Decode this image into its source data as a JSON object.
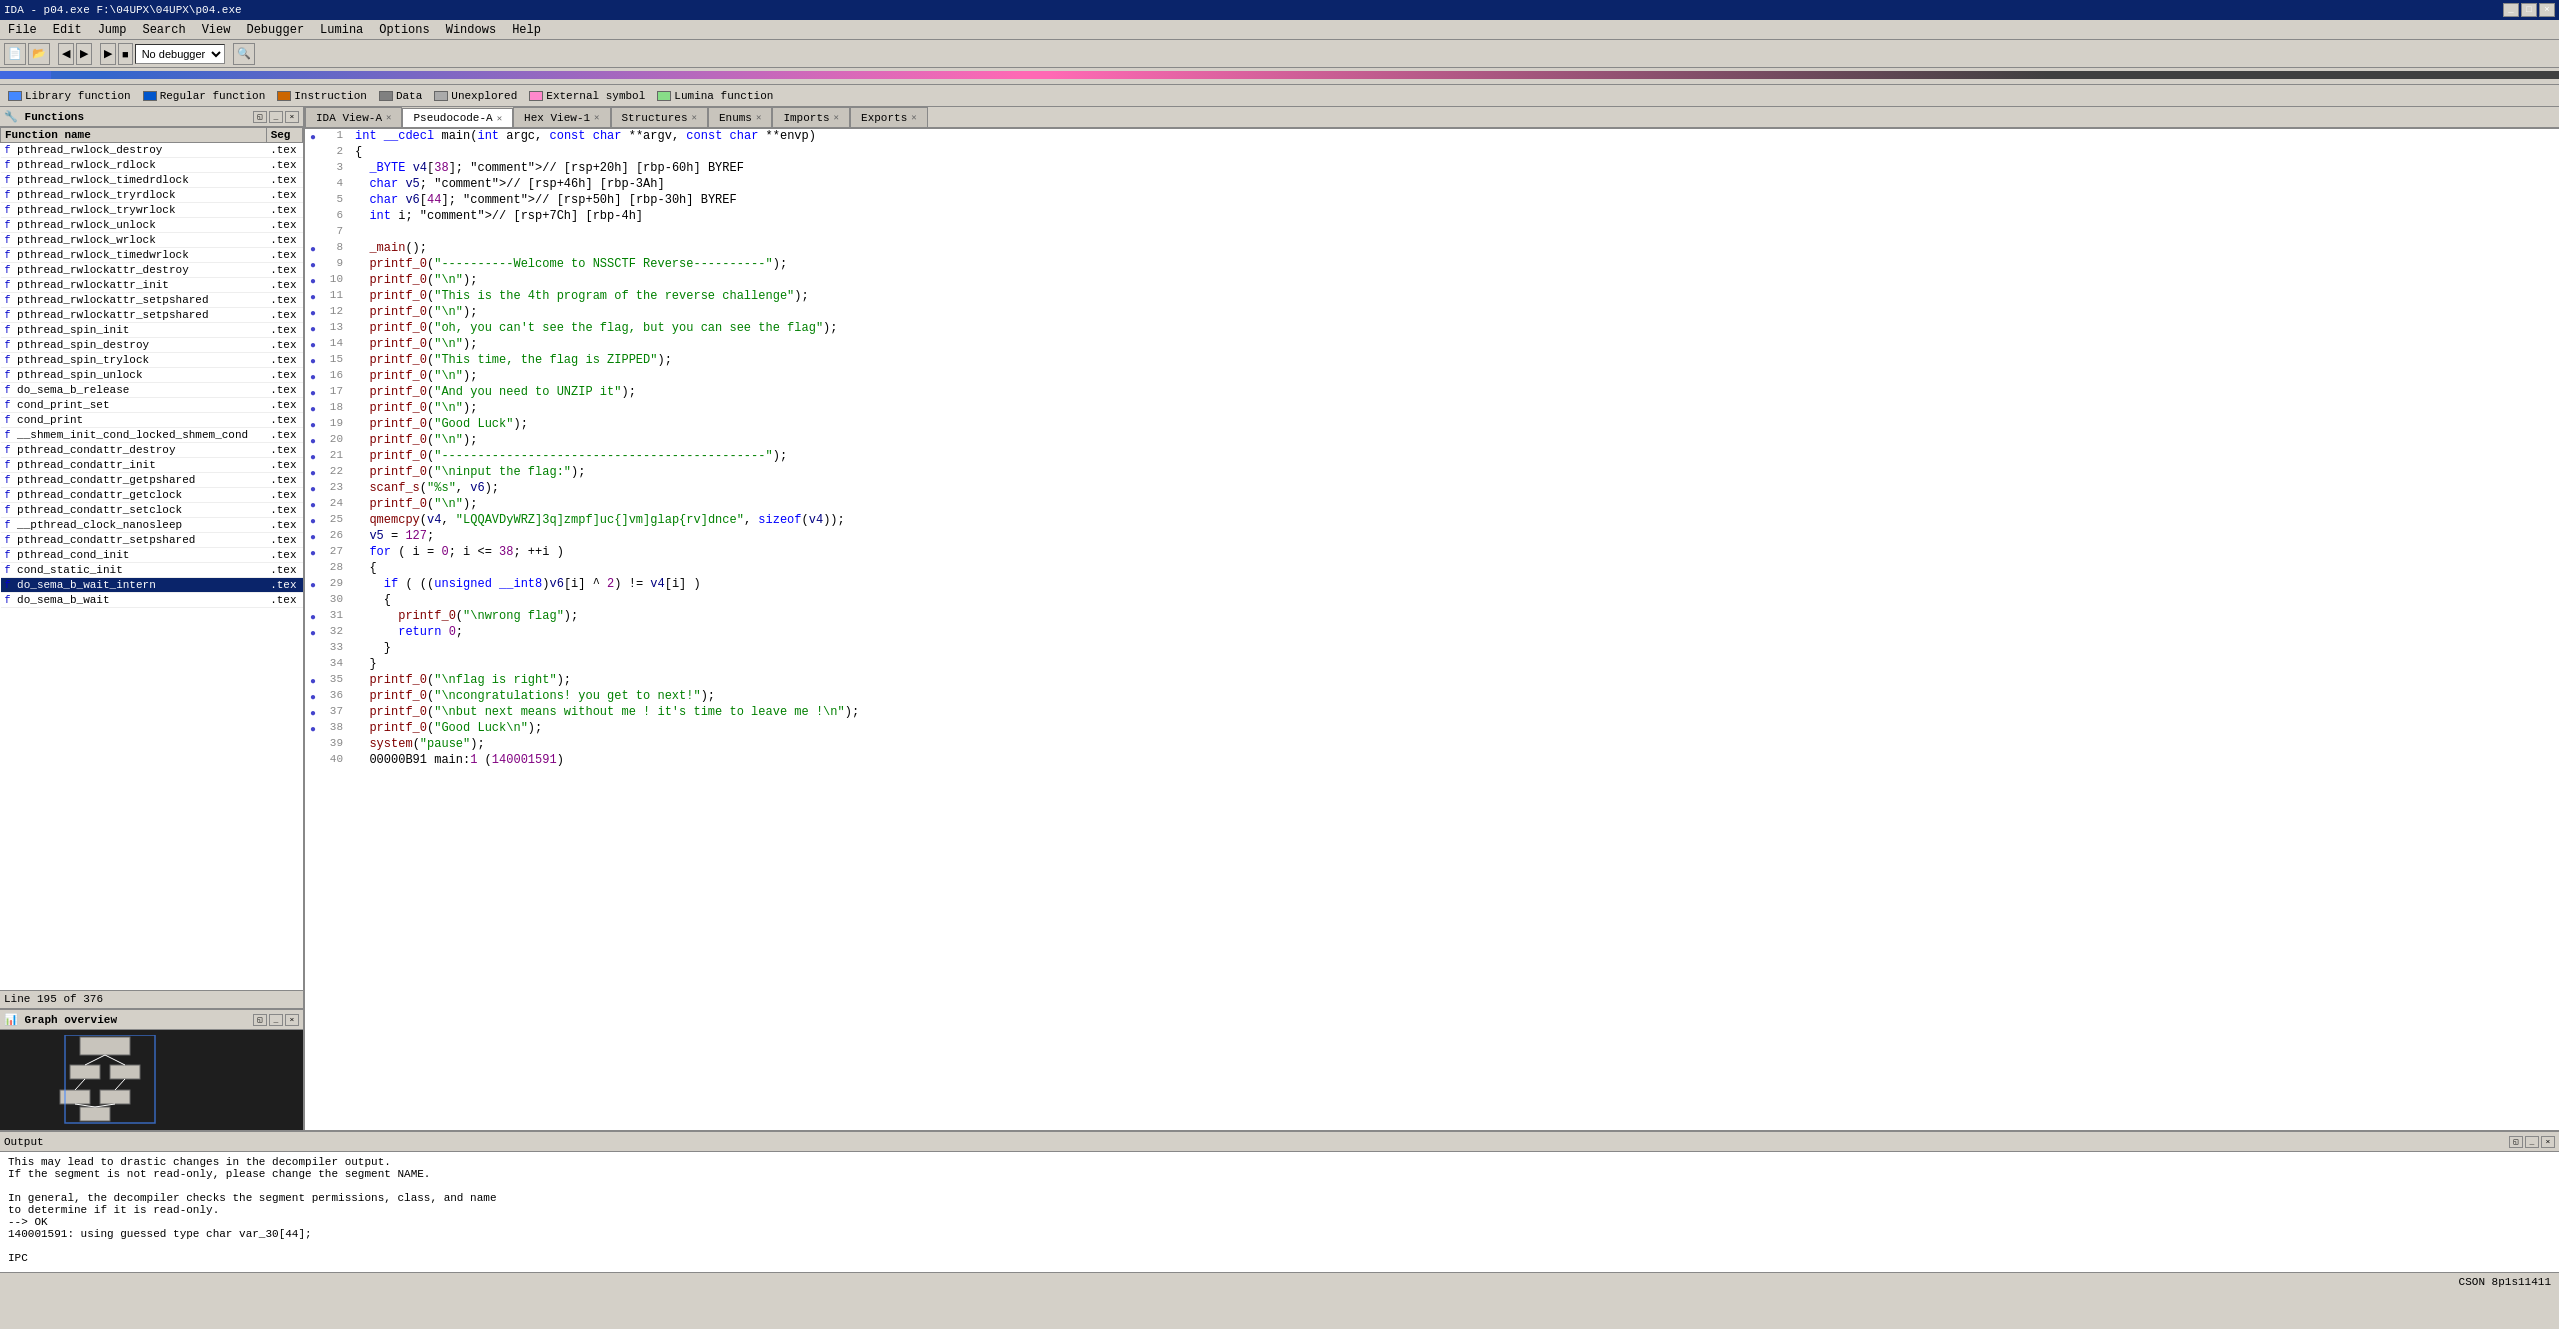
{
  "titlebar": {
    "title": "IDA - p04.exe F:\\04UPX\\04UPX\\p04.exe",
    "buttons": [
      "_",
      "□",
      "×"
    ]
  },
  "menubar": {
    "items": [
      "File",
      "Edit",
      "Jump",
      "Search",
      "View",
      "Debugger",
      "Lumina",
      "Options",
      "Windows",
      "Help"
    ]
  },
  "toolbar": {
    "debugger_select": "No debugger"
  },
  "legend": {
    "items": [
      {
        "color": "#3399ff",
        "label": "Library function"
      },
      {
        "color": "#0055cc",
        "label": "Regular function"
      },
      {
        "color": "#cc6600",
        "label": "Instruction"
      },
      {
        "color": "#808080",
        "label": "Data"
      },
      {
        "color": "#aaaaaa",
        "label": "Unexplored"
      },
      {
        "color": "#ff99cc",
        "label": "External symbol"
      },
      {
        "color": "#99ff99",
        "label": "Lumina function"
      }
    ]
  },
  "functions_panel": {
    "title": "Functions",
    "columns": [
      "Function name",
      "Seg"
    ],
    "items": [
      {
        "icon": "f",
        "name": "pthread_rwlock_destroy",
        "seg": ".tex"
      },
      {
        "icon": "f",
        "name": "pthread_rwlock_rdlock",
        "seg": ".tex"
      },
      {
        "icon": "f",
        "name": "pthread_rwlock_timedrdlock",
        "seg": ".tex"
      },
      {
        "icon": "f",
        "name": "pthread_rwlock_tryrdlock",
        "seg": ".tex"
      },
      {
        "icon": "f",
        "name": "pthread_rwlock_trywrlock",
        "seg": ".tex"
      },
      {
        "icon": "f",
        "name": "pthread_rwlock_unlock",
        "seg": ".tex"
      },
      {
        "icon": "f",
        "name": "pthread_rwlock_wrlock",
        "seg": ".tex"
      },
      {
        "icon": "f",
        "name": "pthread_rwlock_timedwrlock",
        "seg": ".tex"
      },
      {
        "icon": "f",
        "name": "pthread_rwlockattr_destroy",
        "seg": ".tex"
      },
      {
        "icon": "f",
        "name": "pthread_rwlockattr_init",
        "seg": ".tex"
      },
      {
        "icon": "f",
        "name": "pthread_rwlockattr_setpshared",
        "seg": ".tex"
      },
      {
        "icon": "f",
        "name": "pthread_rwlockattr_setpshared",
        "seg": ".tex"
      },
      {
        "icon": "f",
        "name": "pthread_spin_init",
        "seg": ".tex"
      },
      {
        "icon": "f",
        "name": "pthread_spin_destroy",
        "seg": ".tex"
      },
      {
        "icon": "f",
        "name": "pthread_spin_trylock",
        "seg": ".tex"
      },
      {
        "icon": "f",
        "name": "pthread_spin_unlock",
        "seg": ".tex"
      },
      {
        "icon": "f",
        "name": "do_sema_b_release",
        "seg": ".tex"
      },
      {
        "icon": "f",
        "name": "cond_print_set",
        "seg": ".tex"
      },
      {
        "icon": "f",
        "name": "cond_print",
        "seg": ".tex"
      },
      {
        "icon": "f",
        "name": "__shmem_init_cond_locked_shmem_cond",
        "seg": ".tex"
      },
      {
        "icon": "f",
        "name": "pthread_condattr_destroy",
        "seg": ".tex"
      },
      {
        "icon": "f",
        "name": "pthread_condattr_init",
        "seg": ".tex"
      },
      {
        "icon": "f",
        "name": "pthread_condattr_getpshared",
        "seg": ".tex"
      },
      {
        "icon": "f",
        "name": "pthread_condattr_getclock",
        "seg": ".tex"
      },
      {
        "icon": "f",
        "name": "pthread_condattr_setclock",
        "seg": ".tex"
      },
      {
        "icon": "f",
        "name": "__pthread_clock_nanosleep",
        "seg": ".tex"
      },
      {
        "icon": "f",
        "name": "pthread_condattr_setpshared",
        "seg": ".tex"
      },
      {
        "icon": "f",
        "name": "pthread_cond_init",
        "seg": ".tex"
      },
      {
        "icon": "f",
        "name": "cond_static_init",
        "seg": ".tex"
      },
      {
        "icon": "f",
        "name": "do_sema_b_wait_intern",
        "seg": ".tex"
      },
      {
        "icon": "f",
        "name": "do_sema_b_wait",
        "seg": ".tex"
      }
    ],
    "line_info": "Line 195 of 376"
  },
  "graph_panel": {
    "title": "Graph overview"
  },
  "tabs": [
    {
      "label": "IDA View-A",
      "active": false,
      "closeable": true
    },
    {
      "label": "Pseudocode-A",
      "active": true,
      "closeable": true
    },
    {
      "label": "Hex View-1",
      "active": false,
      "closeable": true
    },
    {
      "label": "Structures",
      "active": false,
      "closeable": true
    },
    {
      "label": "Enums",
      "active": false,
      "closeable": true
    },
    {
      "label": "Imports",
      "active": false,
      "closeable": true
    },
    {
      "label": "Exports",
      "active": false,
      "closeable": true
    }
  ],
  "code": {
    "lines": [
      {
        "num": 1,
        "dot": true,
        "text": "int __cdecl main(int argc, const char **argv, const char **envp)"
      },
      {
        "num": 2,
        "dot": false,
        "text": "{"
      },
      {
        "num": 3,
        "dot": false,
        "text": "  _BYTE v4[38]; // [rsp+20h] [rbp-60h] BYREF"
      },
      {
        "num": 4,
        "dot": false,
        "text": "  char v5; // [rsp+46h] [rbp-3Ah]"
      },
      {
        "num": 5,
        "dot": false,
        "text": "  char v6[44]; // [rsp+50h] [rbp-30h] BYREF"
      },
      {
        "num": 6,
        "dot": false,
        "text": "  int i; // [rsp+7Ch] [rbp-4h]"
      },
      {
        "num": 7,
        "dot": false,
        "text": ""
      },
      {
        "num": 8,
        "dot": true,
        "text": "  _main();"
      },
      {
        "num": 9,
        "dot": true,
        "text": "  printf_0(\"----------Welcome to NSSCTF Reverse----------\");"
      },
      {
        "num": 10,
        "dot": true,
        "text": "  printf_0(\"\\n\");"
      },
      {
        "num": 11,
        "dot": true,
        "text": "  printf_0(\"This is the 4th program of the reverse challenge\");"
      },
      {
        "num": 12,
        "dot": true,
        "text": "  printf_0(\"\\n\");"
      },
      {
        "num": 13,
        "dot": true,
        "text": "  printf_0(\"oh, you can't see the flag, but you can see the flag\");"
      },
      {
        "num": 14,
        "dot": true,
        "text": "  printf_0(\"\\n\");"
      },
      {
        "num": 15,
        "dot": true,
        "text": "  printf_0(\"This time, the flag is ZIPPED\");"
      },
      {
        "num": 16,
        "dot": true,
        "text": "  printf_0(\"\\n\");"
      },
      {
        "num": 17,
        "dot": true,
        "text": "  printf_0(\"And you need to UNZIP it\");"
      },
      {
        "num": 18,
        "dot": true,
        "text": "  printf_0(\"\\n\");"
      },
      {
        "num": 19,
        "dot": true,
        "text": "  printf_0(\"Good Luck\");"
      },
      {
        "num": 20,
        "dot": true,
        "text": "  printf_0(\"\\n\");"
      },
      {
        "num": 21,
        "dot": true,
        "text": "  printf_0(\"---------------------------------------------\");"
      },
      {
        "num": 22,
        "dot": true,
        "text": "  printf_0(\"\\ninput the flag:\");"
      },
      {
        "num": 23,
        "dot": true,
        "text": "  scanf_s(\"%s\", v6);"
      },
      {
        "num": 24,
        "dot": true,
        "text": "  printf_0(\"\\n\");"
      },
      {
        "num": 25,
        "dot": true,
        "text": "  qmemcpy(v4, \"LQQAVDyWRZ]3q]zmpf]uc{]vm]glap{rv]dnce\", sizeof(v4));"
      },
      {
        "num": 26,
        "dot": true,
        "text": "  v5 = 127;"
      },
      {
        "num": 27,
        "dot": true,
        "text": "  for ( i = 0; i <= 38; ++i )"
      },
      {
        "num": 28,
        "dot": false,
        "text": "  {"
      },
      {
        "num": 29,
        "dot": true,
        "text": "    if ( ((unsigned __int8)v6[i] ^ 2) != v4[i] )"
      },
      {
        "num": 30,
        "dot": false,
        "text": "    {"
      },
      {
        "num": 31,
        "dot": true,
        "text": "      printf_0(\"\\nwrong flag\");"
      },
      {
        "num": 32,
        "dot": true,
        "text": "      return 0;"
      },
      {
        "num": 33,
        "dot": false,
        "text": "    }"
      },
      {
        "num": 34,
        "dot": false,
        "text": "  }"
      },
      {
        "num": 35,
        "dot": true,
        "text": "  printf_0(\"\\nflag is right\");"
      },
      {
        "num": 36,
        "dot": true,
        "text": "  printf_0(\"\\ncongratulations! you get to next!\");"
      },
      {
        "num": 37,
        "dot": true,
        "text": "  printf_0(\"\\nbut next means without me ! it's time to leave me !\\n\");"
      },
      {
        "num": 38,
        "dot": true,
        "text": "  printf_0(\"Good Luck\\n\");"
      },
      {
        "num": 39,
        "dot": false,
        "text": "  system(\"pause\");"
      },
      {
        "num": 40,
        "dot": false,
        "text": "  00000B91 main:1 (140001591)"
      }
    ]
  },
  "output_panel": {
    "title": "Output",
    "content": [
      "This may lead to drastic changes in the decompiler output.",
      "If the segment is not read-only, please change the segment NAME.",
      "",
      "In general, the decompiler checks the segment permissions, class, and name",
      "to determine if it is read-only.",
      "  --> OK",
      "140001591: using guessed type char var_30[44];",
      "",
      "IPC"
    ]
  },
  "statusbar": {
    "right_text": "CSON 8p1s11411"
  }
}
